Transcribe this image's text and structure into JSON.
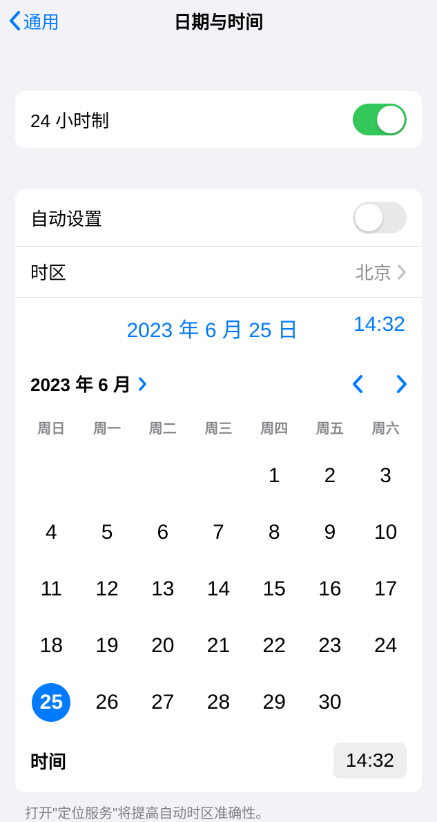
{
  "header": {
    "back_label": "通用",
    "title": "日期与时间"
  },
  "settings": {
    "twenty_four_hour_label": "24 小时制",
    "auto_set_label": "自动设置",
    "timezone_label": "时区",
    "timezone_value": "北京"
  },
  "display": {
    "date": "2023 年 6 月 25 日",
    "time": "14:32"
  },
  "calendar": {
    "month_label": "2023 年 6 月",
    "weekdays": [
      "周日",
      "周一",
      "周二",
      "周三",
      "周四",
      "周五",
      "周六"
    ],
    "leading_blanks": 4,
    "days": 30,
    "selected_day": 25,
    "time_label": "时间",
    "time_value": "14:32"
  },
  "footer": {
    "note": "打开\"定位服务\"将提高自动时区准确性。"
  }
}
